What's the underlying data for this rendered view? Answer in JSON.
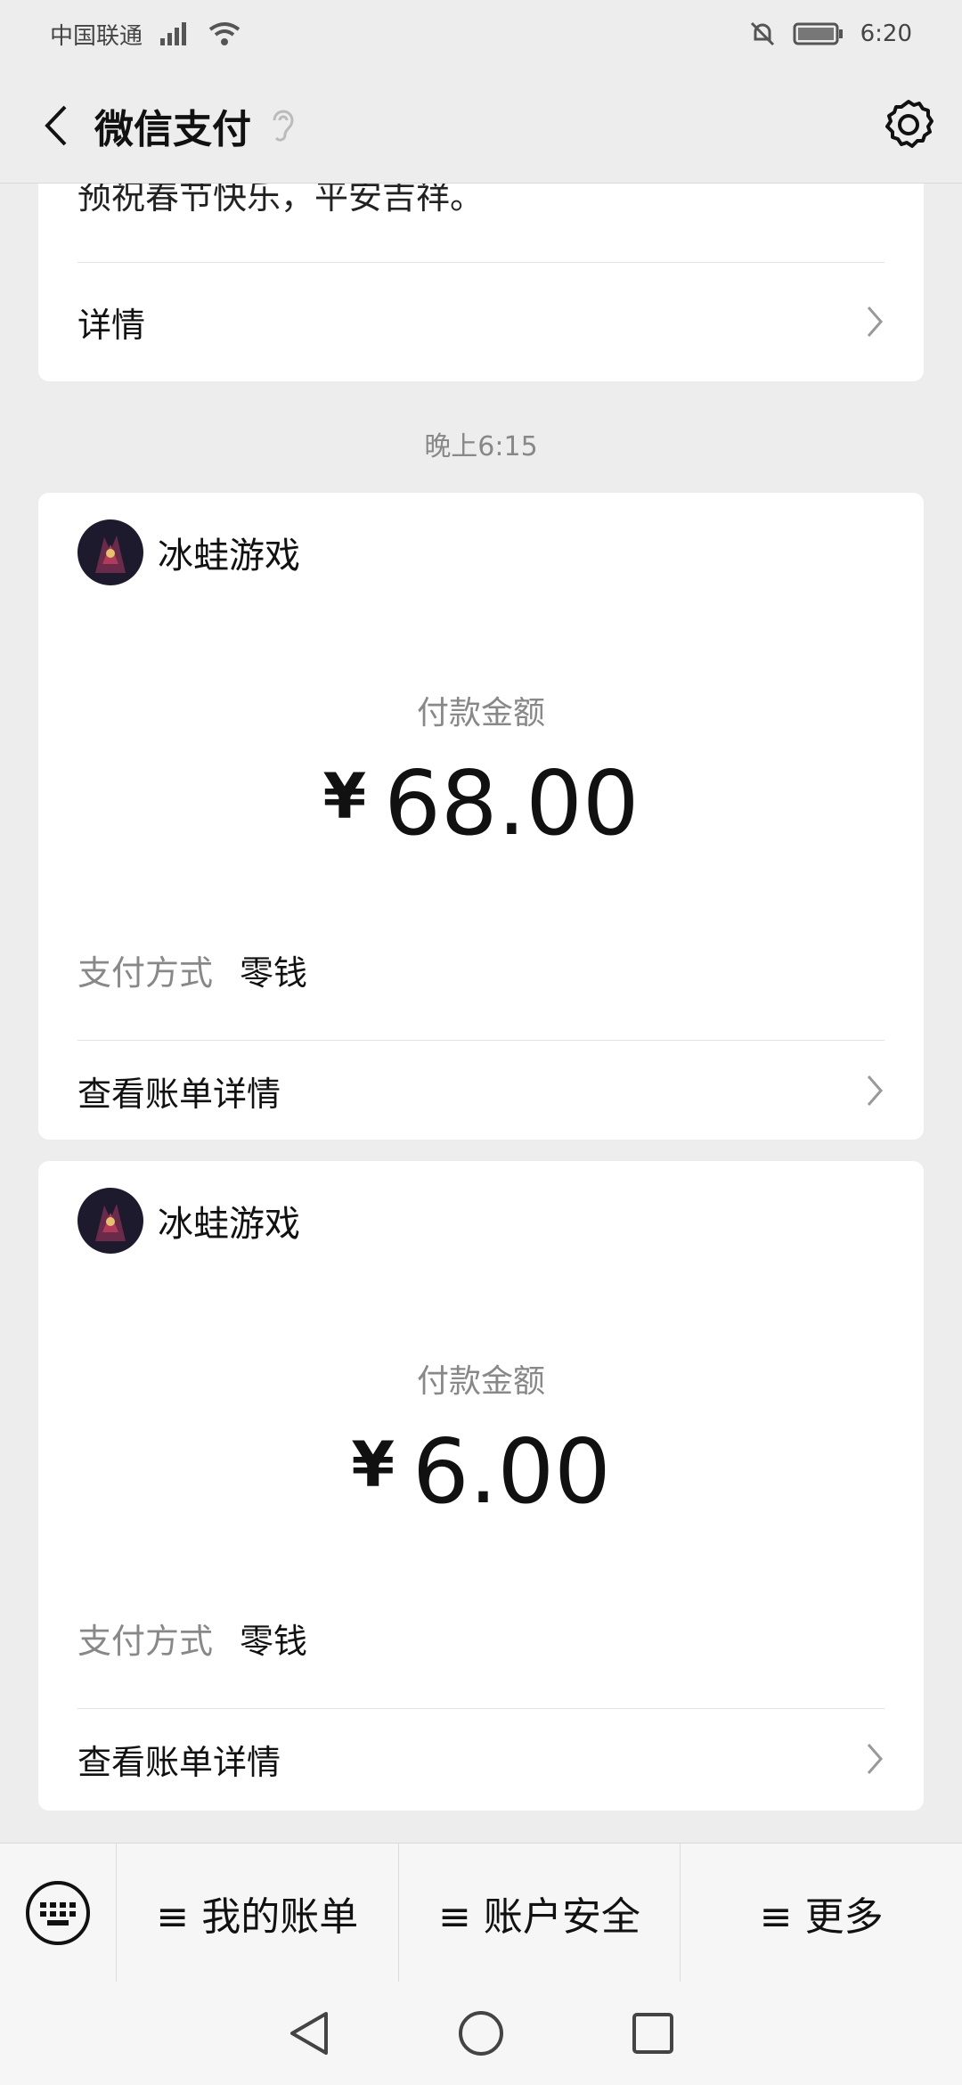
{
  "status_bar": {
    "carrier": "中国联通",
    "time": "6:20"
  },
  "header": {
    "title": "微信支付"
  },
  "top_card": {
    "text": "预祝春节快乐，平安吉祥。",
    "detail_label": "详情"
  },
  "time_separator": "晚上6:15",
  "payments": [
    {
      "merchant": "冰蛙游戏",
      "amount_label": "付款金额",
      "currency": "¥",
      "amount": "68.00",
      "method_label": "支付方式",
      "method_value": "零钱",
      "view_bill": "查看账单详情"
    },
    {
      "merchant": "冰蛙游戏",
      "amount_label": "付款金额",
      "currency": "¥",
      "amount": "6.00",
      "method_label": "支付方式",
      "method_value": "零钱",
      "view_bill": "查看账单详情"
    }
  ],
  "bottom_menu": {
    "items": [
      "≡ 我的账单",
      "≡ 账户安全",
      "≡ 更多"
    ]
  }
}
